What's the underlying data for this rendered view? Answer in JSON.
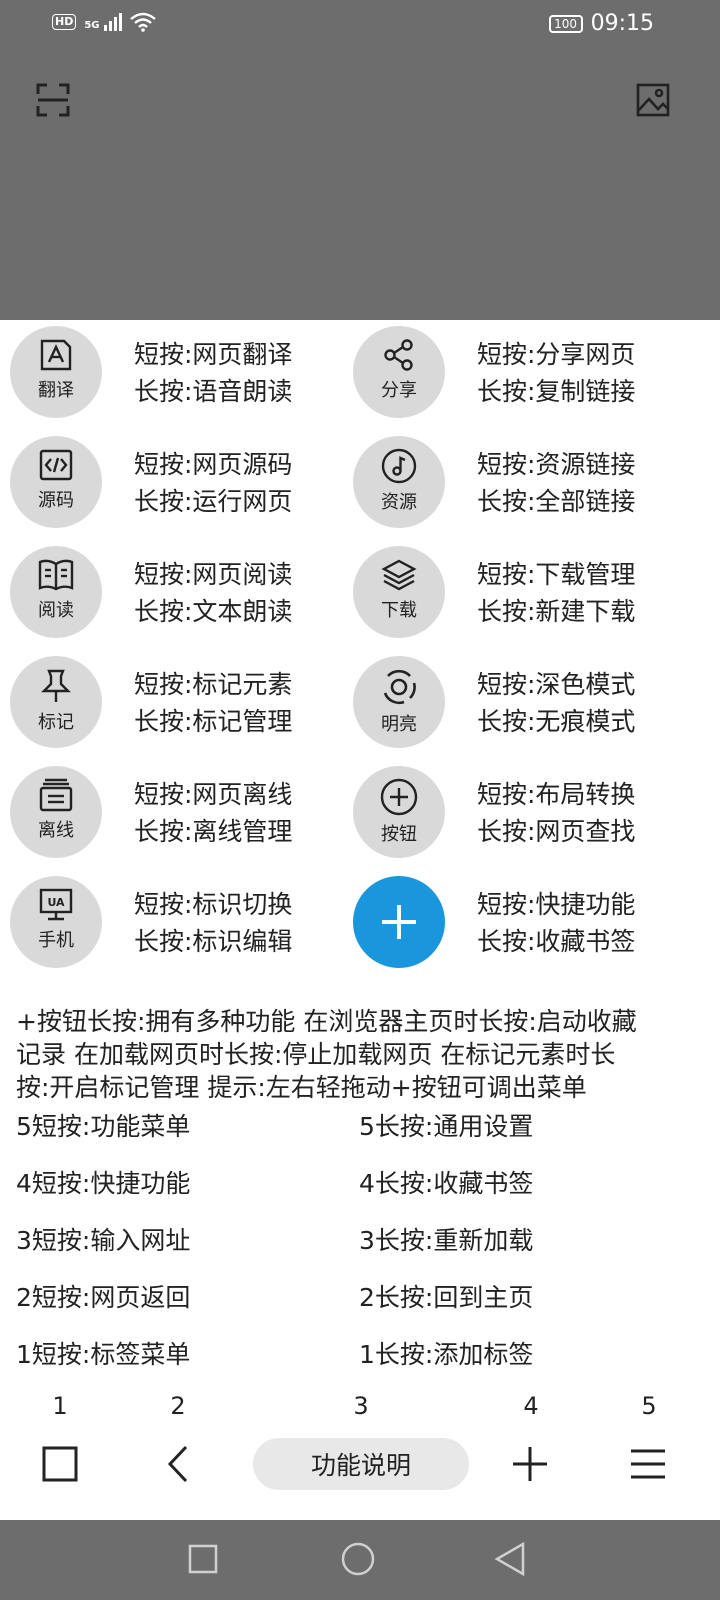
{
  "status_bar": {
    "hd_label": "HD",
    "network": "5G",
    "battery": "100",
    "time": "09:15"
  },
  "panel": {
    "buttons": [
      {
        "icon": "translate-icon",
        "label": "翻译",
        "short": "短按:网页翻译",
        "long": "长按:语音朗读"
      },
      {
        "icon": "share-icon",
        "label": "分享",
        "short": "短按:分享网页",
        "long": "长按:复制链接"
      },
      {
        "icon": "source-code-icon",
        "label": "源码",
        "short": "短按:网页源码",
        "long": "长按:运行网页"
      },
      {
        "icon": "music-note-icon",
        "label": "资源",
        "short": "短按:资源链接",
        "long": "长按:全部链接"
      },
      {
        "icon": "book-icon",
        "label": "阅读",
        "short": "短按:网页阅读",
        "long": "长按:文本朗读"
      },
      {
        "icon": "layers-icon",
        "label": "下载",
        "short": "短按:下载管理",
        "long": "长按:新建下载"
      },
      {
        "icon": "pin-icon",
        "label": "标记",
        "short": "短按:标记元素",
        "long": "长按:标记管理"
      },
      {
        "icon": "brightness-icon",
        "label": "明亮",
        "short": "短按:深色模式",
        "long": "长按:无痕模式"
      },
      {
        "icon": "offline-icon",
        "label": "离线",
        "short": "短按:网页离线",
        "long": "长按:离线管理"
      },
      {
        "icon": "plus-circle-icon",
        "label": "按钮",
        "short": "短按:布局转换",
        "long": "长按:网页查找"
      },
      {
        "icon": "user-agent-icon",
        "label": "手机",
        "short": "短按:标识切换",
        "long": "长按:标识编辑"
      },
      {
        "icon": "plus-icon",
        "label": "",
        "short": "短按:快捷功能",
        "long": "长按:收藏书签"
      }
    ],
    "note_line1": "+按钮长按:拥有多种功能 在浏览器主页时长按:启动收藏",
    "note_line2": "记录 在加载网页时长按:停止加载网页 在标记元素时长",
    "note_line3": "按:开启标记管理 提示:左右轻拖动+按钮可调出菜单",
    "hints": [
      {
        "short": "5短按:功能菜单",
        "long": "5长按:通用设置"
      },
      {
        "short": "4短按:快捷功能",
        "long": "4长按:收藏书签"
      },
      {
        "short": "3短按:输入网址",
        "long": "3长按:重新加载"
      },
      {
        "short": "2短按:网页返回",
        "long": "2长按:回到主页"
      },
      {
        "short": "1短按:标签菜单",
        "long": "1长按:添加标签"
      }
    ]
  },
  "toolbar": {
    "numbers": [
      "1",
      "2",
      "3",
      "4",
      "5"
    ],
    "center_label": "功能说明"
  },
  "colors": {
    "accent": "#1a96dc",
    "overlay": "#6d6d6d",
    "circle": "#d9d9d9"
  }
}
